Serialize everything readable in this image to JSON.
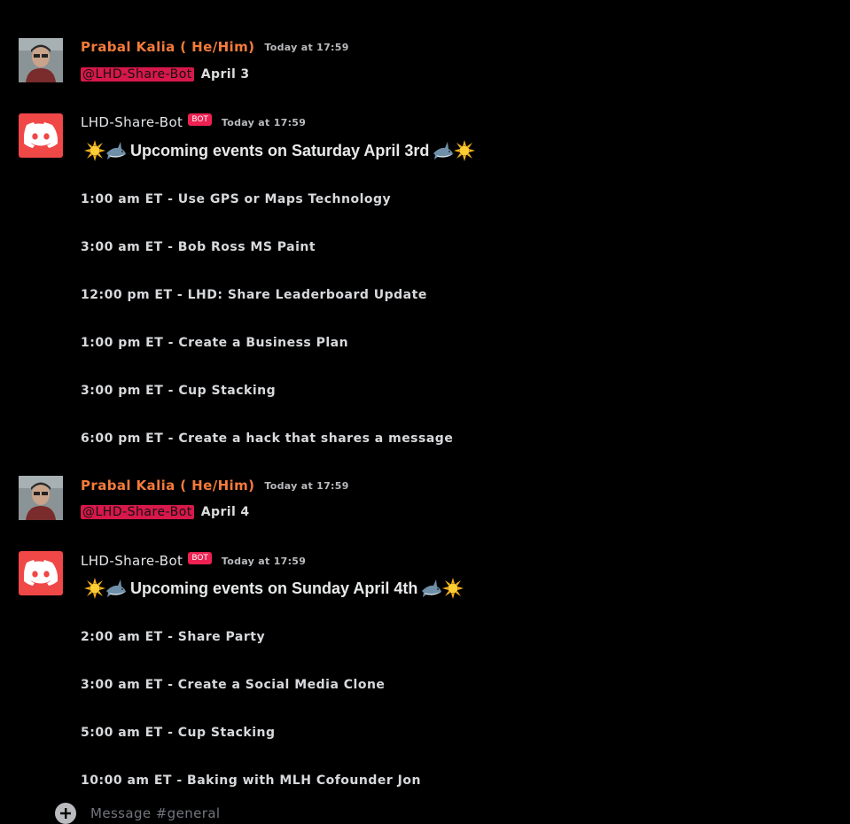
{
  "messages": [
    {
      "author": "Prabal Kalia ( He/Him)",
      "timestamp": "Today at 17:59",
      "mention": "@LHD-Share-Bot",
      "text": "April 3"
    },
    {
      "author": "LHD-Share-Bot",
      "bot_tag": "BOT",
      "timestamp": "Today at 17:59",
      "heading": "Upcoming events on Saturday April 3rd",
      "events": [
        "1:00 am ET - Use GPS or Maps Technology",
        "3:00 am ET - Bob Ross MS Paint",
        "12:00 pm ET - LHD: Share Leaderboard Update",
        "1:00 pm ET - Create a Business Plan",
        "3:00 pm ET - Cup Stacking",
        "6:00 pm ET - Create a hack that shares a message"
      ]
    },
    {
      "author": "Prabal Kalia ( He/Him)",
      "timestamp": "Today at 17:59",
      "mention": "@LHD-Share-Bot",
      "text": "April 4"
    },
    {
      "author": "LHD-Share-Bot",
      "bot_tag": "BOT",
      "timestamp": "Today at 17:59",
      "heading": "Upcoming events on Sunday April 4th",
      "events": [
        "2:00 am ET - Share Party",
        "3:00 am ET - Create a Social Media Clone",
        "5:00 am ET - Cup Stacking",
        "10:00 am ET - Baking with MLH Cofounder Jon"
      ]
    }
  ],
  "heading_emojis": [
    "sun-icon",
    "shark-icon"
  ],
  "composer": {
    "placeholder": "Message #general",
    "add_icon": "plus-circle-icon"
  },
  "colors": {
    "background": "#000000",
    "user_name": "#f47b3b",
    "mention_bg": "#d6184a",
    "bot_tag_bg": "#ed2152",
    "bot_avatar": "#f04747"
  }
}
